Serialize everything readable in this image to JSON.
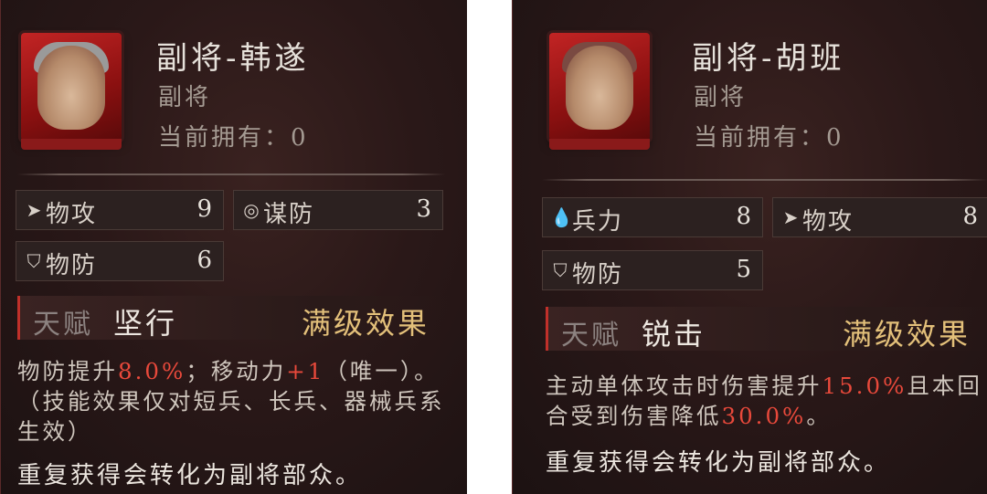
{
  "cards": [
    {
      "name": "副将-韩遂",
      "role": "副将",
      "owned": "当前拥有：0",
      "stats": [
        {
          "label": "物攻",
          "value": "9",
          "icon": "cursor-arrow-icon"
        },
        {
          "label": "谋防",
          "value": "3",
          "icon": "swirl-icon"
        },
        {
          "label": "物防",
          "value": "6",
          "icon": "shield-icon"
        }
      ],
      "talent": {
        "label": "天赋",
        "name": "坚行",
        "maxlevel": "满级效果"
      },
      "desc": {
        "p1": "物防提升",
        "v1": "8.0%",
        "p2": "；移动力",
        "v2": "+1",
        "p3": "（唯一）。（技能效果仅对短兵、长兵、器械兵系生效）"
      },
      "repeat": "重复获得会转化为副将部众。"
    },
    {
      "name": "副将-胡班",
      "role": "副将",
      "owned": "当前拥有：0",
      "stats": [
        {
          "label": "兵力",
          "value": "8",
          "icon": "drop-icon"
        },
        {
          "label": "物攻",
          "value": "8",
          "icon": "cursor-arrow-icon"
        },
        {
          "label": "物防",
          "value": "5",
          "icon": "shield-icon"
        }
      ],
      "talent": {
        "label": "天赋",
        "name": "锐击",
        "maxlevel": "满级效果"
      },
      "desc": {
        "p1": "主动单体攻击时伤害提升",
        "v1": "15.0%",
        "p2": "且本回合受到伤害降低",
        "v2": "30.0%",
        "p3": "。"
      },
      "repeat": "重复获得会转化为副将部众。"
    }
  ],
  "colors": {
    "highlight": "#e8493b",
    "gold": "#e3c07a",
    "accent_red": "#c0302a"
  }
}
